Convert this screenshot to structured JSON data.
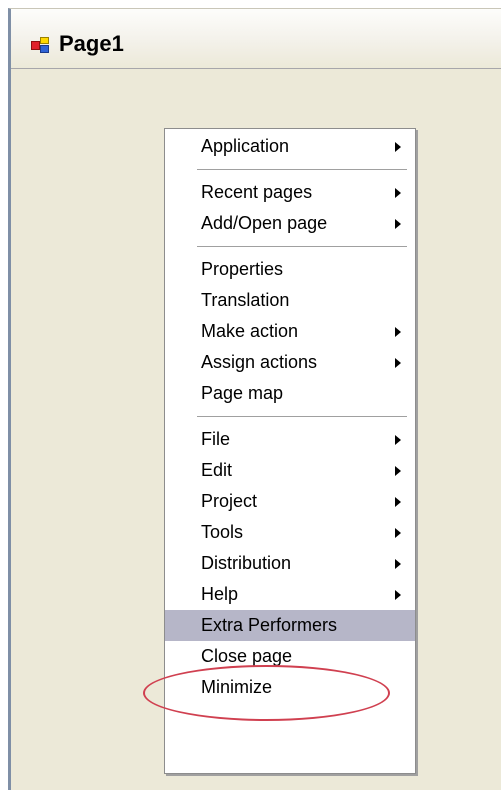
{
  "window": {
    "title": "Page1",
    "icon": "app-icon"
  },
  "context_menu": {
    "groups": [
      [
        {
          "label": "Application",
          "submenu": true
        }
      ],
      [
        {
          "label": "Recent pages",
          "submenu": true
        },
        {
          "label": "Add/Open page",
          "submenu": true
        }
      ],
      [
        {
          "label": "Properties",
          "submenu": false
        },
        {
          "label": "Translation",
          "submenu": false
        },
        {
          "label": "Make action",
          "submenu": true
        },
        {
          "label": "Assign actions",
          "submenu": true
        },
        {
          "label": "Page map",
          "submenu": false
        }
      ],
      [
        {
          "label": "File",
          "submenu": true
        },
        {
          "label": "Edit",
          "submenu": true
        },
        {
          "label": "Project",
          "submenu": true
        },
        {
          "label": "Tools",
          "submenu": true
        },
        {
          "label": "Distribution",
          "submenu": true
        },
        {
          "label": "Help",
          "submenu": true
        },
        {
          "label": "Extra Performers",
          "submenu": false,
          "highlighted": true
        },
        {
          "label": "Close page",
          "submenu": false
        },
        {
          "label": "Minimize",
          "submenu": false
        }
      ]
    ]
  },
  "annotation": {
    "type": "oval",
    "target": "Extra Performers",
    "color": "#d04050"
  },
  "colors": {
    "window_bg": "#ece9d8",
    "highlight": "#b6b6c8"
  }
}
